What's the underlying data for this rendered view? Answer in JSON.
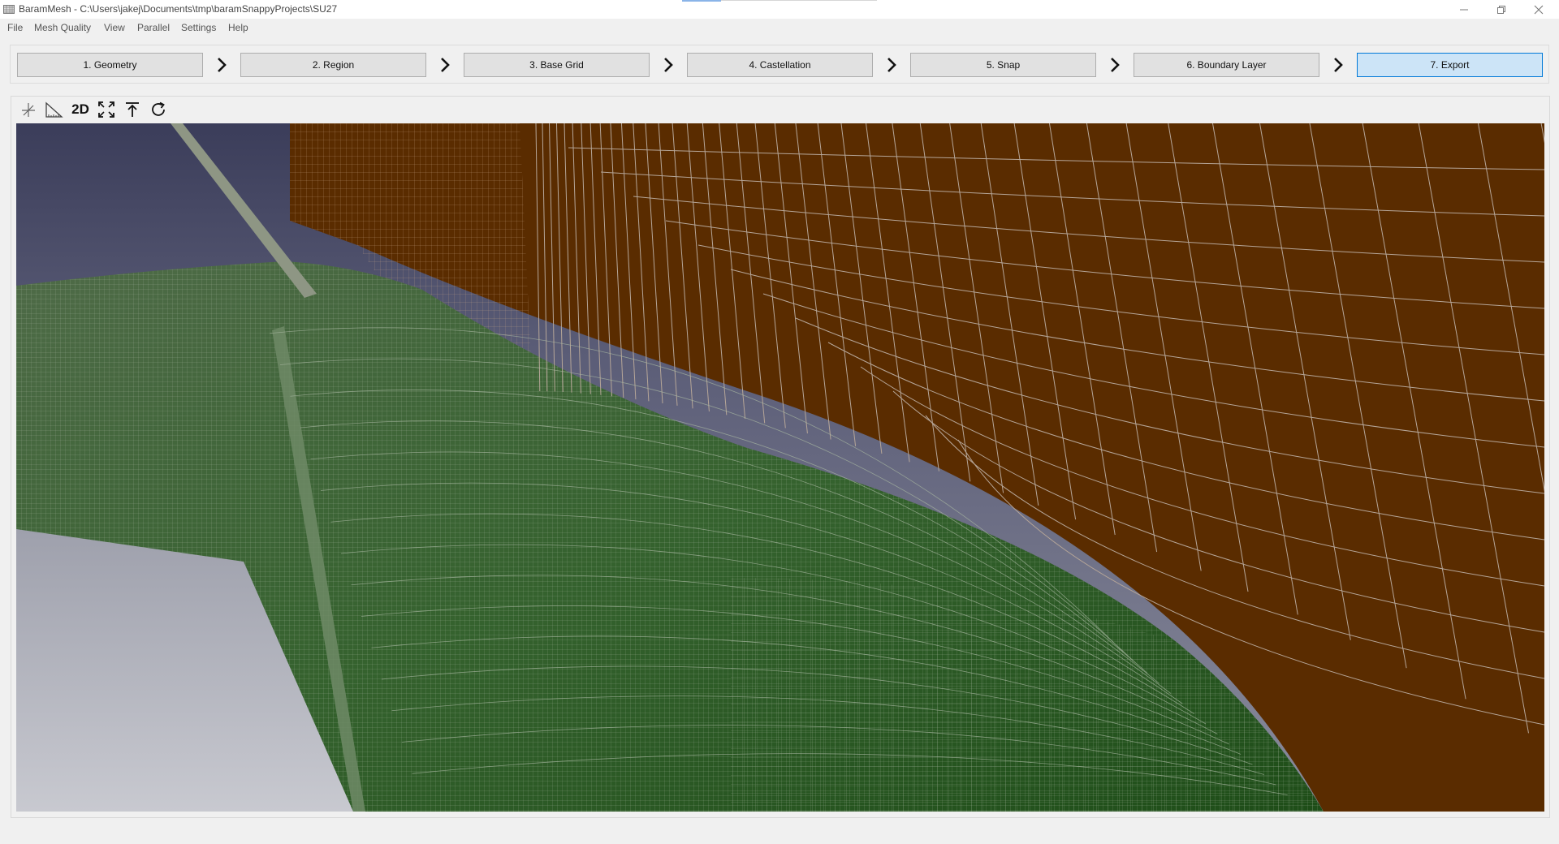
{
  "window": {
    "title": "BaramMesh - C:\\Users\\jakej\\Documents\\tmp\\baramSnappyProjects\\SU27",
    "app_icon": "baram-mesh-app-icon",
    "controls": [
      "minimize-icon",
      "restore-icon",
      "close-icon"
    ]
  },
  "menu": {
    "items": [
      "File",
      "Mesh Quality",
      "View",
      "Parallel",
      "Settings",
      "Help"
    ]
  },
  "steps": {
    "items": [
      {
        "label": "1. Geometry",
        "active": false
      },
      {
        "label": "2. Region",
        "active": false
      },
      {
        "label": "3. Base Grid",
        "active": false
      },
      {
        "label": "4. Castellation",
        "active": false
      },
      {
        "label": "5. Snap",
        "active": false
      },
      {
        "label": "6. Boundary Layer",
        "active": false
      },
      {
        "label": "7. Export",
        "active": true
      }
    ],
    "separator_icon": "chevron-right-icon"
  },
  "toolbar": {
    "tools": [
      {
        "icon": "axes-icon"
      },
      {
        "icon": "ruler-triangle-icon"
      },
      {
        "icon": "text-2d",
        "label": "2D"
      },
      {
        "icon": "fit-view-icon"
      },
      {
        "icon": "align-top-icon"
      },
      {
        "icon": "rotate-icon"
      }
    ]
  },
  "viewport": {
    "content": "3d-mesh-render",
    "colors": {
      "background_top": "#3b3d5a",
      "background_bottom": "#8a8c9c",
      "wall": "#5a2c00",
      "surface": "#2b5a25",
      "surface_dark": "#1e4d18",
      "grid_line": "#b0a8a0",
      "panel": "#c8c9d0"
    }
  },
  "colors": {
    "accent": "#0078d7",
    "active_step_bg": "#cce4f7",
    "button_bg": "#e1e1e1"
  }
}
